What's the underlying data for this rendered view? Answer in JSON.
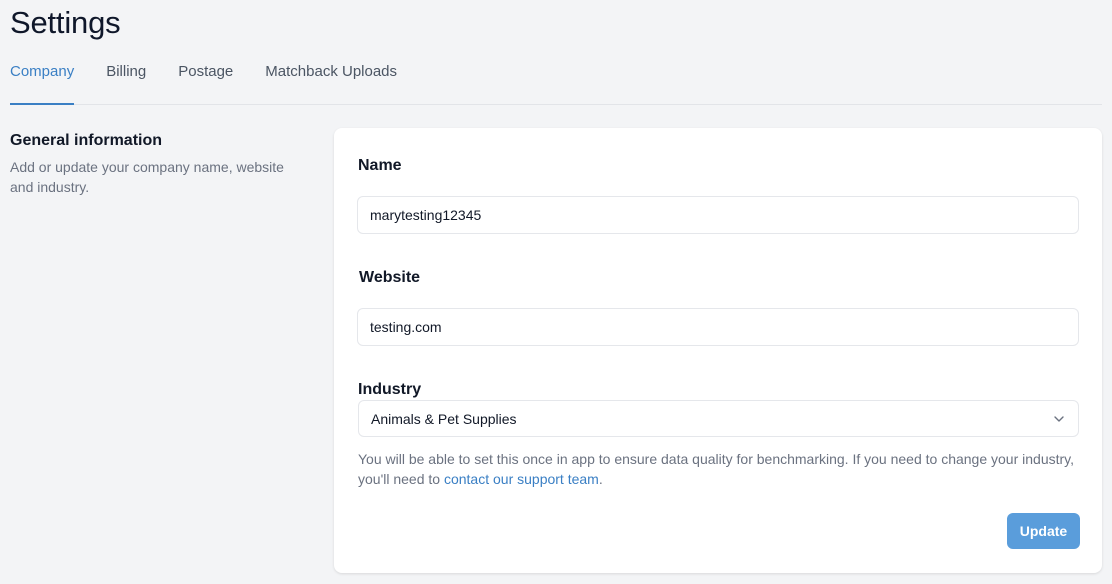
{
  "page": {
    "title": "Settings"
  },
  "tabs": [
    {
      "label": "Company",
      "active": true
    },
    {
      "label": "Billing",
      "active": false
    },
    {
      "label": "Postage",
      "active": false
    },
    {
      "label": "Matchback Uploads",
      "active": false
    }
  ],
  "section": {
    "title": "General information",
    "description": "Add or update your company name, website and industry."
  },
  "form": {
    "name": {
      "label": "Name",
      "value": "marytesting12345"
    },
    "website": {
      "label": "Website",
      "value": "testing.com"
    },
    "industry": {
      "label": "Industry",
      "selected": "Animals & Pet Supplies",
      "help_prefix": "You will be able to set this once in app to ensure data quality for benchmarking. If you need to change your industry, you'll need to ",
      "help_link": "contact our support team",
      "help_suffix": "."
    },
    "update_label": "Update"
  },
  "icons": {
    "select_chevron": "chevron-down-icon"
  },
  "colors": {
    "accent": "#3a7fc4",
    "button": "#5a9ddb",
    "background": "#f3f4f6",
    "card": "#ffffff"
  }
}
